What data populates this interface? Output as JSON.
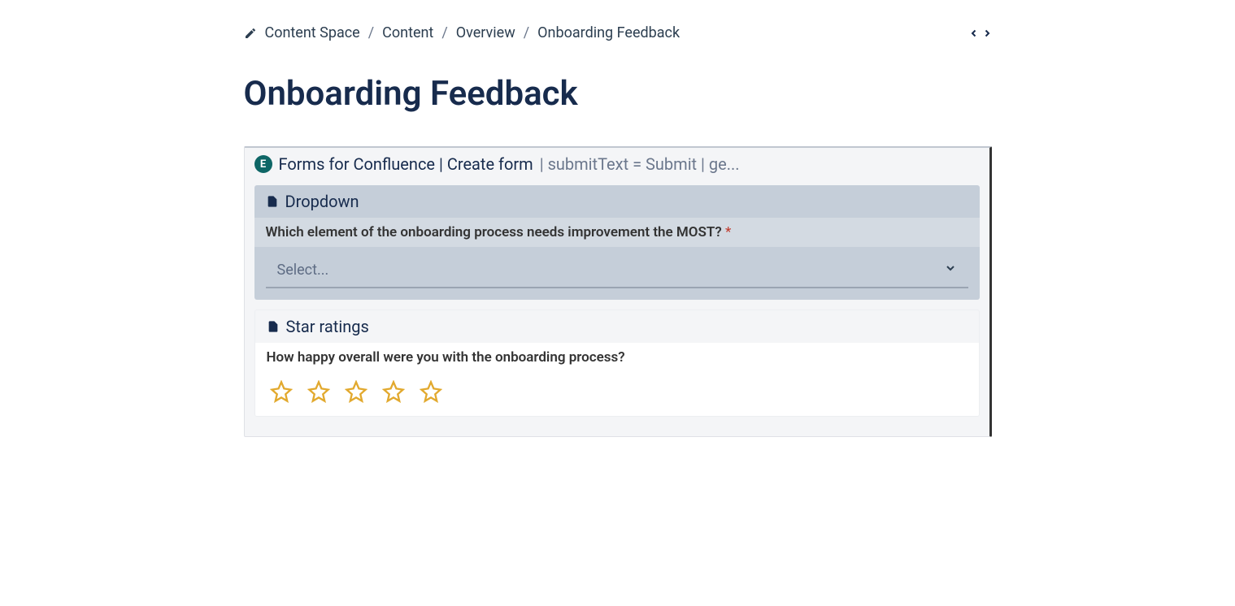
{
  "breadcrumb": {
    "items": [
      "Content Space",
      "Content",
      "Overview",
      "Onboarding Feedback"
    ]
  },
  "page": {
    "title": "Onboarding Feedback"
  },
  "macro": {
    "name": "Forms for Confluence | Create form",
    "params": "| submitText = Submit | ge..."
  },
  "form": {
    "blocks": [
      {
        "type": "Dropdown",
        "label": "Which element of the onboarding process needs improvement the MOST?",
        "required": true,
        "placeholder": "Select..."
      },
      {
        "type": "Star ratings",
        "label": "How happy overall were you with the onboarding process?",
        "required": false,
        "stars": 5
      }
    ]
  }
}
